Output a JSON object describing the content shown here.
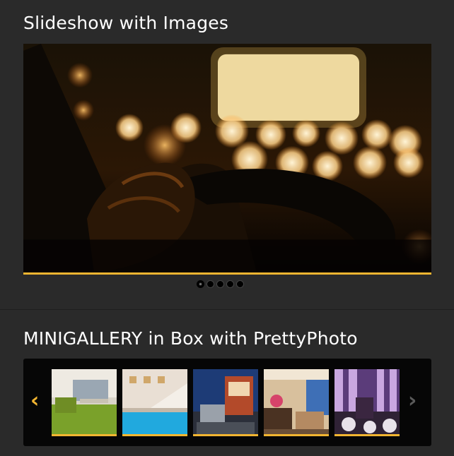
{
  "slideshow": {
    "title": "Slideshow with Images",
    "image_alt": "Night driving bokeh photo",
    "active_slide": 1,
    "slide_count": 5,
    "accent_color": "#f2b531"
  },
  "gallery": {
    "title": "MINIGALLERY in Box with PrettyPhoto",
    "prev_arrow": "‹",
    "next_arrow": "›",
    "thumbnails": [
      {
        "alt": "Lobby with green carpet"
      },
      {
        "alt": "Terrace pool at dusk"
      },
      {
        "alt": "Modern building at night"
      },
      {
        "alt": "Hotel room with flowers"
      },
      {
        "alt": "Purple lounge interior"
      }
    ]
  }
}
